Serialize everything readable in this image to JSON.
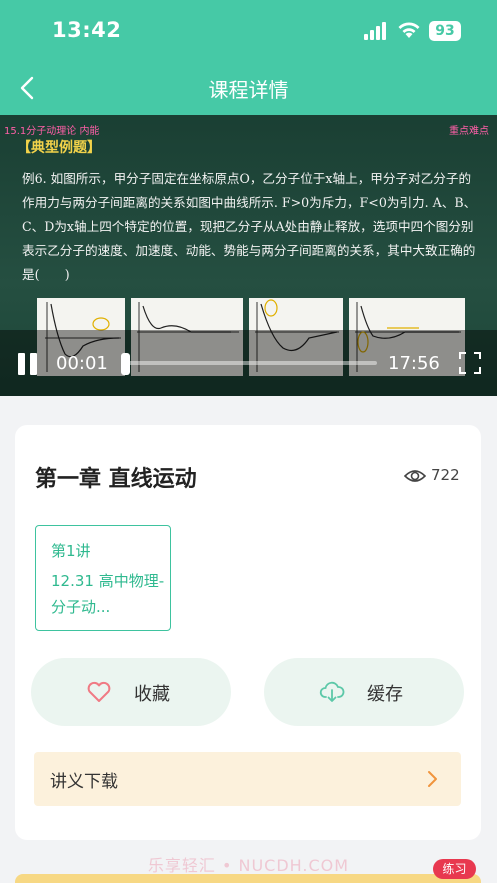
{
  "status_bar": {
    "time": "13:42",
    "battery": "93"
  },
  "nav": {
    "title": "课程详情"
  },
  "video": {
    "tag_left": "15.1分子动理论 内能",
    "tag_right": "重点难点",
    "heading": "【典型例题】",
    "body": "例6. 如图所示，甲分子固定在坐标原点O，乙分子位于x轴上，甲分子对乙分子的作用力与两分子间距离的关系如图中曲线所示. F>0为斥力，F<0为引力. A、B、C、D为x轴上四个特定的位置，现把乙分子从A处由静止释放，选项中四个图分别表示乙分子的速度、加速度、动能、势能与两分子间距离的关系，其中大致正确的是(　　)",
    "current_time": "00:01",
    "total_time": "17:56",
    "progress": 0.001
  },
  "course": {
    "chapter_title": "第一章 直线运动",
    "views": "722",
    "lesson": {
      "number": "第1讲",
      "name": "12.31 高中物理-分子动..."
    },
    "favorite_label": "收藏",
    "cache_label": "缓存",
    "handout_label": "讲义下载"
  },
  "footer": {
    "watermark": "乐享轻汇 • NUCDH.COM",
    "practice_label": "练习"
  },
  "colors": {
    "accent": "#46c9a6",
    "favorite_icon": "#f07a84",
    "cache_icon": "#5cc8a8",
    "handout_arrow": "#f0943c",
    "practice_badge": "#e8384f"
  }
}
